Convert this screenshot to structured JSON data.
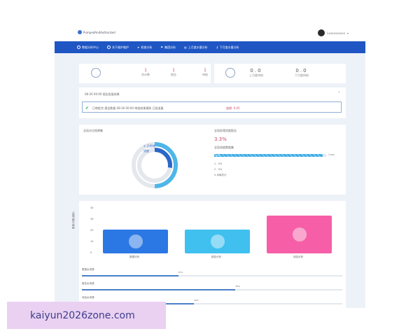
{
  "app": {
    "title": "PumpedAndAuthorized",
    "user_name": "Lxxxxxxxxxx"
  },
  "nav": {
    "items": [
      {
        "label": "数据分析中心"
      },
      {
        "label": "关于维护维护"
      },
      {
        "label": "检查分析"
      },
      {
        "label": "集团分析"
      },
      {
        "label": "上月度水量分析"
      },
      {
        "label": "下月度水量分析"
      }
    ]
  },
  "stats_left": {
    "items": [
      {
        "value": "1",
        "label": "合计数"
      },
      {
        "value": "1",
        "label": "报告"
      },
      {
        "value": "1",
        "label": "待结"
      }
    ]
  },
  "stats_right": {
    "items": [
      {
        "value": "0.0",
        "label": "上月度待结"
      },
      {
        "value": "0.0",
        "label": "下月度待结"
      }
    ]
  },
  "alert": {
    "header": "08-26 00:00 报告批复结果",
    "message": "已审批完 报告数量 08-26 00:00 审批结果通知 已批准量",
    "highlight": "逾期: 0.45"
  },
  "donut_card": {
    "title": "全局水位结果集",
    "legend": "+ 已完成",
    "legend2": "进度",
    "ticks": [
      "10%",
      "20%",
      "30%",
      "40%",
      "50%",
      "60%",
      "70%",
      "80%",
      "90%",
      "100%"
    ]
  },
  "progress_card": {
    "title": "全局处理进度报告",
    "big_value": "3.3%",
    "sub_title": "全局进度数据集",
    "bar_percent": 97,
    "bar_label": "97%",
    "bar_right": "3,500",
    "legend_items": [
      "1 - 5%",
      "2 - 5%",
      "4 水库总计"
    ]
  },
  "bar_chart": {
    "ylabel": "数量/次数(通用)",
    "yticks": [
      "40",
      "30",
      "20",
      "10",
      "0"
    ],
    "bars": [
      {
        "label": "数据分析",
        "value": 21,
        "color": "#2b78e4"
      },
      {
        "label": "报告分析",
        "value": 21,
        "color": "#3fc0ef"
      },
      {
        "label": "待结分析",
        "value": 34,
        "color": "#f65fa7"
      }
    ]
  },
  "progress_rows": [
    {
      "label": "数据水资源",
      "percent": 37,
      "text": "37%"
    },
    {
      "label": "报告水资源",
      "percent": 59,
      "text": "59%"
    },
    {
      "label": "待结水资源",
      "percent": 43,
      "text": "43%"
    }
  ],
  "watermark": {
    "text": "kaiyun2026zone.com"
  },
  "colors": {
    "nav_bg": "#1f56c4",
    "accent": "#3b6fd1",
    "pink": "#f65fa7"
  }
}
